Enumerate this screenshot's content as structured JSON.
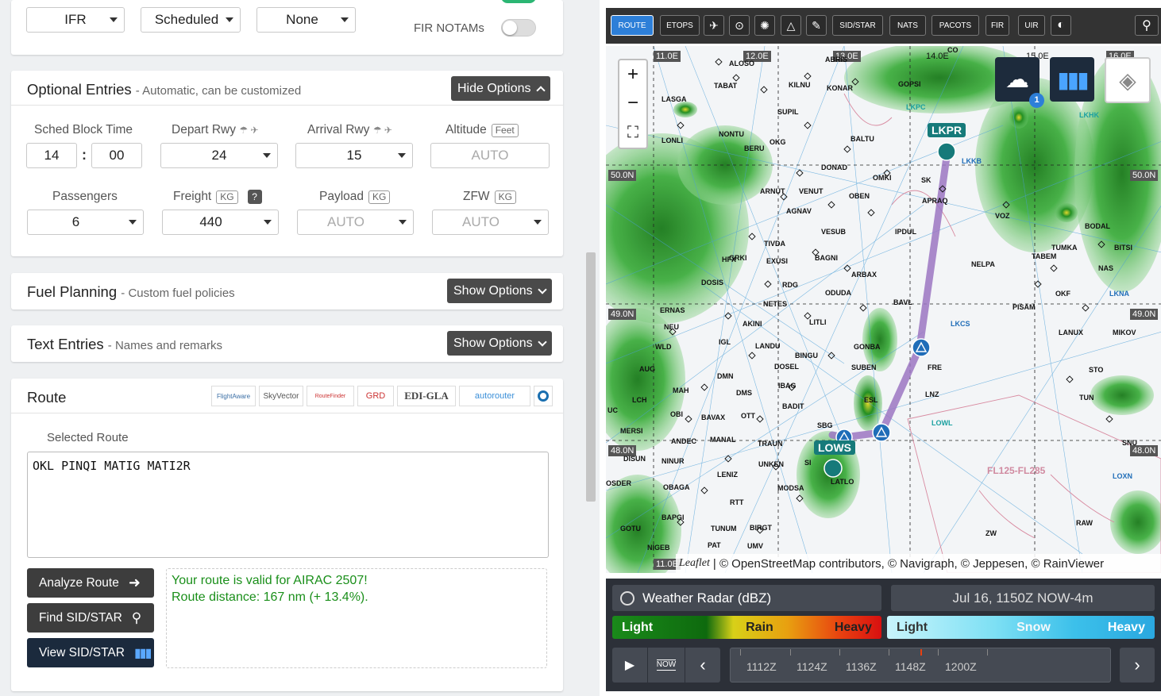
{
  "flight": {
    "rules": "IFR",
    "type": "Scheduled",
    "extra": "None",
    "fir_notams_label": "FIR NOTAMs"
  },
  "optional": {
    "title": "Optional Entries",
    "subtitle": "- Automatic, can be customized",
    "toggle": "Hide Options",
    "sched_label": "Sched Block Time",
    "sched_h": "14",
    "sched_sep": ":",
    "sched_m": "00",
    "dep_label": "Depart Rwy",
    "dep_val": "24",
    "arr_label": "Arrival Rwy",
    "arr_val": "15",
    "alt_label": "Altitude",
    "alt_unit": "Feet",
    "alt_val": "AUTO",
    "pax_label": "Passengers",
    "pax_val": "6",
    "freight_label": "Freight",
    "freight_unit": "KG",
    "freight_help": "?",
    "freight_val": "440",
    "payload_label": "Payload",
    "payload_unit": "KG",
    "payload_val": "AUTO",
    "zfw_label": "ZFW",
    "zfw_unit": "KG",
    "zfw_val": "AUTO"
  },
  "fuel": {
    "title": "Fuel Planning",
    "subtitle": "- Custom fuel policies",
    "toggle": "Show Options"
  },
  "text": {
    "title": "Text Entries",
    "subtitle": "- Names and remarks",
    "toggle": "Show Options"
  },
  "route": {
    "title": "Route",
    "providers": [
      "FlightAware",
      "SkyVector",
      "RouteFinder",
      "GRD",
      "EDI-GLA",
      "autorouter"
    ],
    "selected_label": "Selected Route",
    "route_text": "OKL PINQI MATIG MATI2R",
    "analyze": "Analyze Route",
    "find": "Find SID/STAR",
    "view": "View SID/STAR",
    "result_line1": "Your route is valid for AIRAC 2507!",
    "result_line2": "Route distance: 167 nm (+ 13.4%)."
  },
  "map": {
    "tools": [
      "ROUTE",
      "ETOPS",
      "SID/STAR",
      "NATS",
      "PACOTS",
      "FIR",
      "UIR"
    ],
    "longitudes": [
      "11.0E",
      "12.0E",
      "13.0E",
      "14.0E",
      "15.0E",
      "16.0E"
    ],
    "latitudes": [
      "50.0N",
      "49.0N",
      "48.0N"
    ],
    "airports": {
      "dep": "LOWS",
      "arr": "LKPR"
    },
    "weather_badge": "1",
    "attribution": "| © OpenStreetMap contributors, © Navigraph, © Jeppesen, © RainViewer",
    "leaflet": "Leaflet",
    "fl_band": "FL125-FL285",
    "waypoints": [
      "ALOSO",
      "ABRIS",
      "TABAT",
      "KILNU",
      "KONAR",
      "GOPSI",
      "LASGA",
      "SUPIL",
      "LKPC",
      "LKHK",
      "LONLI",
      "NONTU",
      "OKG",
      "BALTU",
      "LKKB",
      "BERU",
      "DONAD",
      "OMKI",
      "SK",
      "APRAQ",
      "ARNUT",
      "VENUT",
      "OBEN",
      "AGNAV",
      "VESUB",
      "IPDUL",
      "VOZ",
      "BODAL",
      "TIVDA",
      "EXUSI",
      "BAGNI",
      "TUMKA",
      "BITSI",
      "HFX",
      "DOSIS",
      "RDG",
      "ARBAX",
      "NELPA",
      "TABEM",
      "NAS",
      "NETES",
      "ODUDA",
      "BAVL",
      "OKF",
      "LKNA",
      "ERNAS",
      "AKINI",
      "LITLI",
      "LKCS",
      "PISAM",
      "LANUX",
      "MIKOV",
      "NEU",
      "WLD",
      "IGL",
      "LANDU",
      "GONBA",
      "AUG",
      "DMN",
      "BINGU",
      "SUBEN",
      "FRE",
      "STO",
      "MAH",
      "DOSEL",
      "IBAG",
      "ESL",
      "LNZ",
      "TUN",
      "LCH",
      "DMS",
      "BADIT",
      "LOWL",
      "UC",
      "OBI",
      "BAVAX",
      "OTT",
      "SBG",
      "MERSI",
      "ANDEC",
      "MANAL",
      "TRAUN",
      "DISUN",
      "NINUR",
      "UNKEN",
      "LENIZ",
      "LATLO",
      "LOXN",
      "SNU",
      "OSDER",
      "OBAGA",
      "MODSA",
      "BAPGI",
      "RTT",
      "RAW",
      "GOTU",
      "TUNUM",
      "BIRGT",
      "NIGEB",
      "PAT",
      "UMV",
      "ZW",
      "GRKI",
      "SI",
      "CO"
    ]
  },
  "radar": {
    "title": "Weather Radar (dBZ)",
    "time": "Jul 16, 1150Z NOW-4m",
    "rain": [
      "Light",
      "Rain",
      "Heavy"
    ],
    "snow": [
      "Light",
      "Snow",
      "Heavy"
    ],
    "now_label": "NOW",
    "times": [
      "1112Z",
      "1124Z",
      "1136Z",
      "1148Z",
      "1200Z"
    ]
  }
}
